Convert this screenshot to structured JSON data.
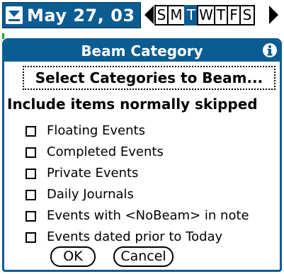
{
  "topbar": {
    "date": "May 27, 03",
    "days": [
      "S",
      "M",
      "T",
      "W",
      "T",
      "F",
      "S"
    ],
    "selected_day_index": 2,
    "accent": "#0c5c94"
  },
  "dialog": {
    "title": "Beam Category",
    "select_label": "Select Categories to Beam...",
    "section_label": "Include items normally skipped",
    "options": [
      {
        "label": "Floating Events",
        "checked": false
      },
      {
        "label": "Completed Events",
        "checked": false
      },
      {
        "label": "Private Events",
        "checked": false
      },
      {
        "label": "Daily Journals",
        "checked": false
      },
      {
        "label": "Events with <NoBeam> in note",
        "checked": false
      },
      {
        "label": "Events dated prior to Today",
        "checked": false
      }
    ],
    "ok_label": "OK",
    "cancel_label": "Cancel"
  },
  "icons": {
    "date_menu": "calendar-menu-icon",
    "prev": "triangle-left-icon",
    "next": "triangle-right-icon",
    "info": "info-icon"
  }
}
